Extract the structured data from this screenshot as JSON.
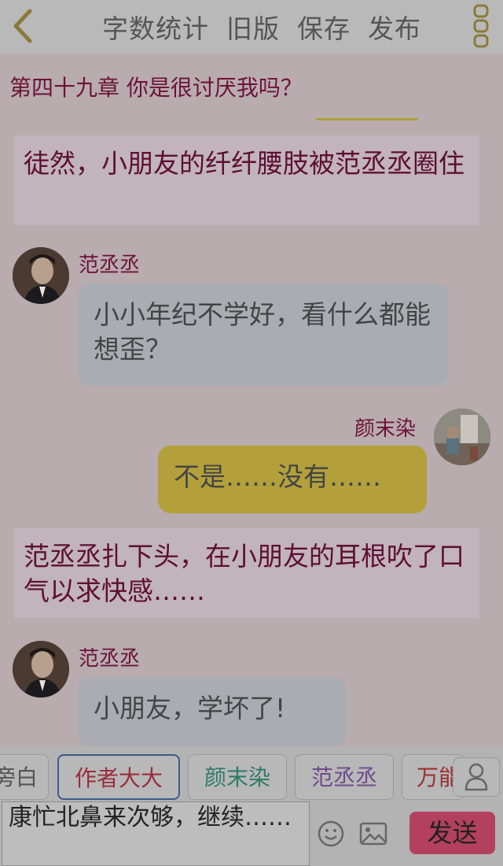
{
  "header": {
    "actions": [
      "字数统计",
      "旧版",
      "保存",
      "发布"
    ]
  },
  "chapter": {
    "title": "第四十九章  你是很讨厌我吗？"
  },
  "messages": {
    "narration1": "徒然，小朋友的纤纤腰肢被范丞丞圈住",
    "msg1_name": "范丞丞",
    "msg1_text": "小小年纪不学好，看什么都能想歪？",
    "msg2_name": "颜末染",
    "msg2_text": "不是……没有……",
    "narration2": "范丞丞扎下头，在小朋友的耳根吹了口气以求快感……",
    "msg3_name": "范丞丞",
    "msg3_text": "小朋友，学坏了!"
  },
  "characters": [
    {
      "label": "旁白",
      "color": "#555555"
    },
    {
      "label": "作者大大",
      "color": "#9a2c3c"
    },
    {
      "label": "颜末染",
      "color": "#2f7a66"
    },
    {
      "label": "范丞丞",
      "color": "#6e4b8a"
    },
    {
      "label": "万能",
      "color": "#9a3030"
    }
  ],
  "composer": {
    "input_value": "康忙北鼻来次够，继续……",
    "send_label": "发送"
  },
  "colors": {
    "accent": "#b3405e",
    "narration_text": "#5e0e33"
  },
  "icons": [
    "back-icon",
    "more-icon",
    "user-icon",
    "emoji-icon",
    "image-icon"
  ]
}
